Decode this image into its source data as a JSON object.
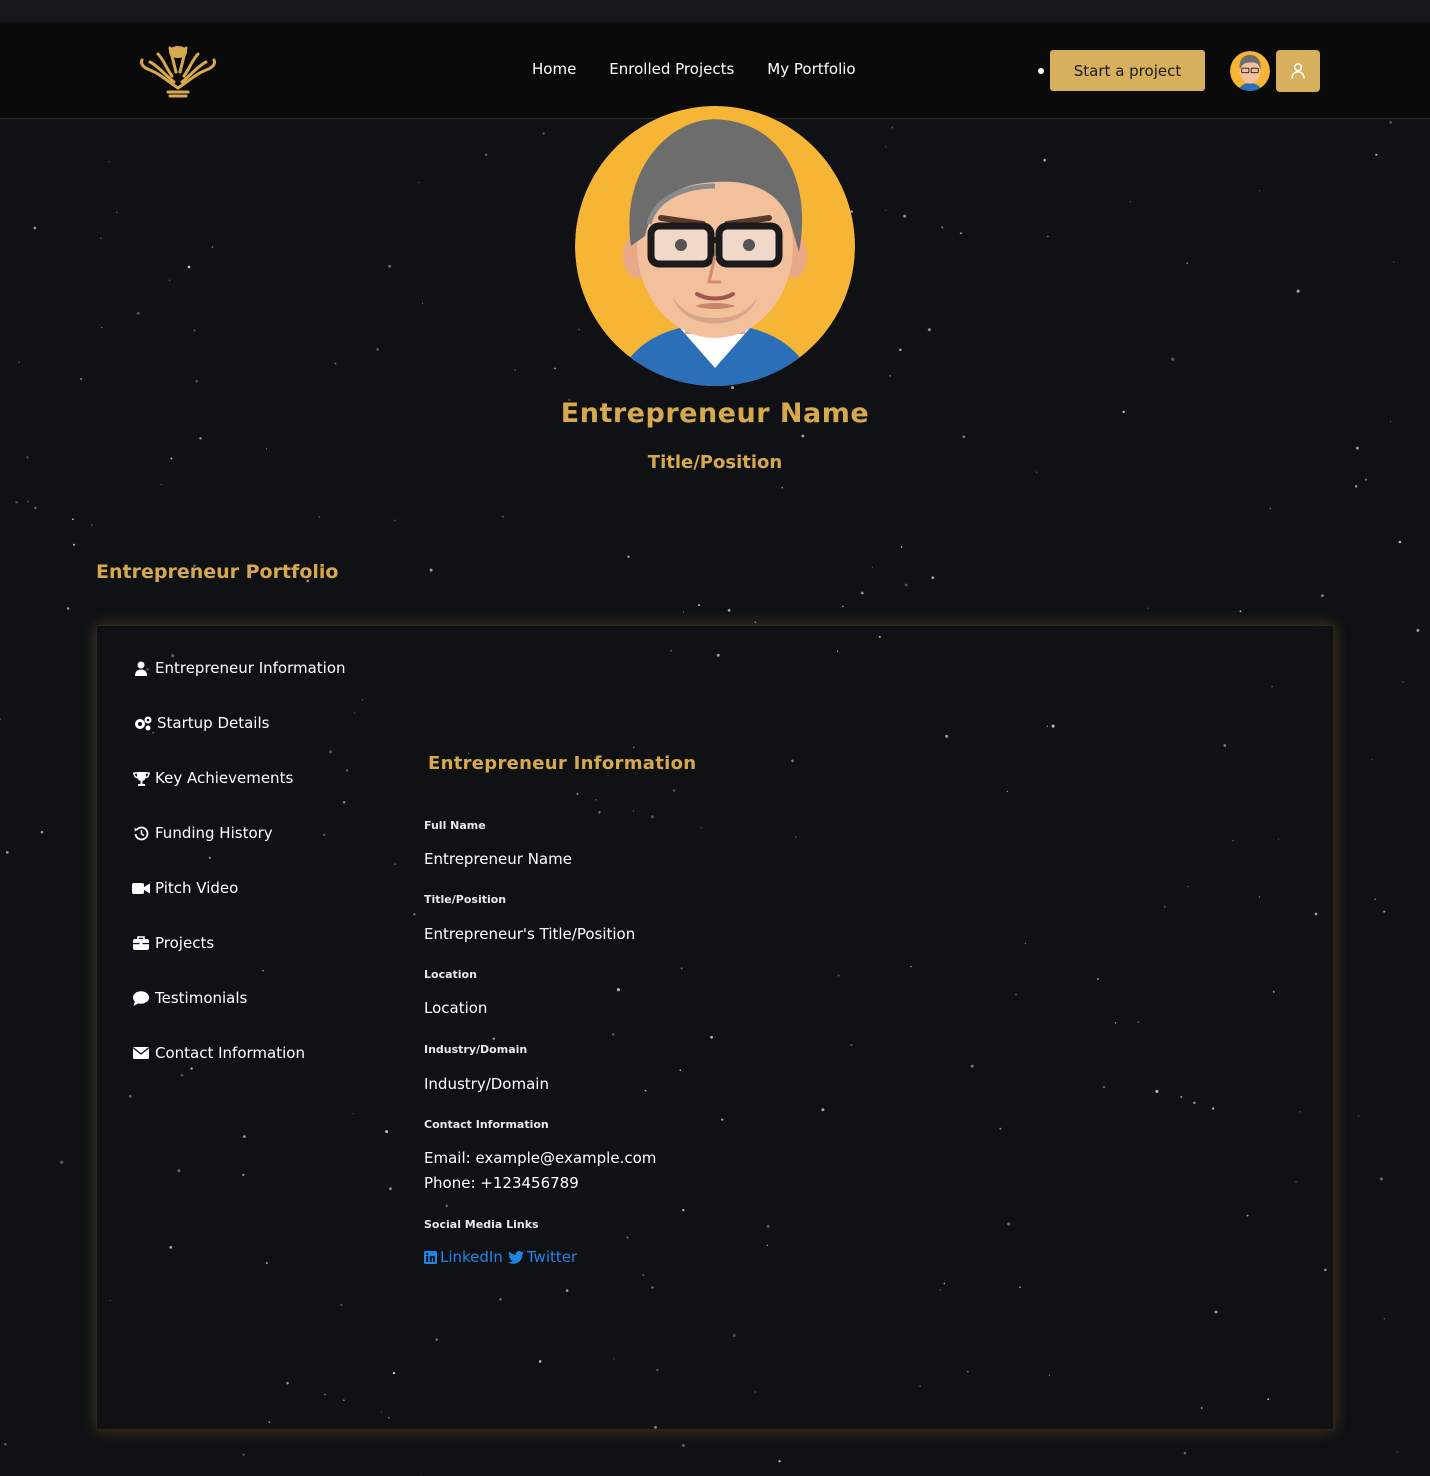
{
  "nav": {
    "links": [
      "Home",
      "Enrolled Projects",
      "My Portfolio"
    ],
    "cta_label": "Start a project"
  },
  "profile": {
    "name": "Entrepreneur Name",
    "title": "Title/Position"
  },
  "portfolio": {
    "section_title": "Entrepreneur Portfolio",
    "sidebar": [
      {
        "label": "Entrepreneur Information",
        "icon": "user-icon"
      },
      {
        "label": "Startup Details",
        "icon": "gears-icon"
      },
      {
        "label": "Key Achievements",
        "icon": "trophy-icon"
      },
      {
        "label": "Funding History",
        "icon": "history-icon"
      },
      {
        "label": "Pitch Video",
        "icon": "video-camera-icon"
      },
      {
        "label": "Projects",
        "icon": "briefcase-icon"
      },
      {
        "label": "Testimonials",
        "icon": "comment-icon"
      },
      {
        "label": "Contact Information",
        "icon": "envelope-icon"
      }
    ],
    "info": {
      "heading": "Entrepreneur Information",
      "fields": [
        {
          "label": "Full Name",
          "value": "Entrepreneur Name"
        },
        {
          "label": "Title/Position",
          "value": "Entrepreneur's Title/Position"
        },
        {
          "label": "Location",
          "value": "Location"
        },
        {
          "label": "Industry/Domain",
          "value": "Industry/Domain"
        }
      ],
      "contact_label": "Contact Information",
      "email": "Email: example@example.com",
      "phone": "Phone: +123456789",
      "social_label": "Social Media Links",
      "linkedin": "LinkedIn",
      "twitter": "Twitter"
    }
  },
  "colors": {
    "accent": "#d7a94e",
    "button": "#d7b05e",
    "background": "#101114",
    "link": "#1f86e8"
  }
}
